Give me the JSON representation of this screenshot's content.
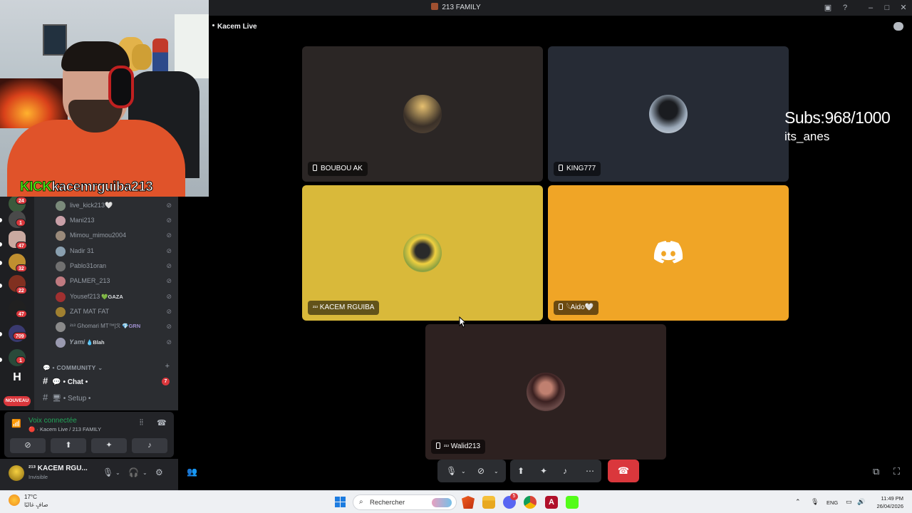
{
  "window": {
    "title": "213 FAMILY"
  },
  "stage": {
    "label": "Kacem Live"
  },
  "overlay": {
    "kick_brand": "KICK",
    "kick_channel": "kacemrguiba213",
    "subs_text": "Subs:968/1000",
    "sub_name": "its_anes"
  },
  "participants": [
    {
      "name": "BOUBOU AK",
      "mobile": true,
      "tile_color": "#2b2625",
      "avatar_color": "#6e5a4a"
    },
    {
      "name": "KING777",
      "mobile": true,
      "tile_color": "#262b35",
      "avatar_color": "#3a3f4a"
    },
    {
      "name": "KACEM RGUIBA",
      "mobile": false,
      "prefix": "²¹³",
      "tile_color": "#d9b93a",
      "avatar_color": "#b08a2a"
    },
    {
      "name": "Aido🤍",
      "mobile": true,
      "prefix": "𓆩",
      "tile_color": "#f0a526",
      "avatar_color": "discord"
    },
    {
      "name": "Walid213",
      "mobile": true,
      "prefix": "²¹³",
      "tile_color": "#2d2120",
      "avatar_color": "#5a3a38"
    }
  ],
  "guild_badges": [
    "24",
    "1",
    "47",
    "32",
    "22",
    "47",
    "709",
    "1"
  ],
  "guild_new_label": "NOUVEAU",
  "voice_members": [
    {
      "name": "live_kick213🤍",
      "tag": "",
      "color": "#7a8a7a"
    },
    {
      "name": "Mani213",
      "tag": "",
      "color": "#c9a0a8"
    },
    {
      "name": "Mimou_mimou2004",
      "tag": "",
      "color": "#9a8a7a"
    },
    {
      "name": "Nadir 31",
      "tag": "",
      "color": "#8aa0b0"
    },
    {
      "name": "Pablo31oran",
      "tag": "",
      "color": "#707070"
    },
    {
      "name": "PALMER_213",
      "tag": "",
      "color": "#c07a80"
    },
    {
      "name": "Yousef213",
      "tag": "💚GAZA",
      "color": "#a03030"
    },
    {
      "name": "ZAT MAT FAT",
      "tag": "",
      "color": "#a08030"
    },
    {
      "name": "²¹³ Ghomari MT™|ℛ",
      "tag": "💎GRN",
      "color": "#8a8a8a"
    },
    {
      "name": "𝒀𝒂𝒎𝒊",
      "tag": "💧Blah",
      "color": "#9a9ab0"
    }
  ],
  "categories": {
    "community": "COMMUNITY"
  },
  "channels": [
    {
      "name": "Chat",
      "active": true,
      "badge": "7"
    },
    {
      "name": "Setup",
      "active": false,
      "badge": ""
    }
  ],
  "voice_panel": {
    "status": "Voix connectée",
    "location": "Kacem Live / 213 FAMILY"
  },
  "user_panel": {
    "name": "²¹³ KACEM RGU...",
    "status": "Invisible"
  },
  "taskbar": {
    "temperature": "17°C",
    "weather_text": "صافٍ غالبًا",
    "search_placeholder": "Rechercher",
    "language": "ENG",
    "time": "11:49 PM",
    "date": "26/04/2026",
    "discord_badge": "5"
  }
}
